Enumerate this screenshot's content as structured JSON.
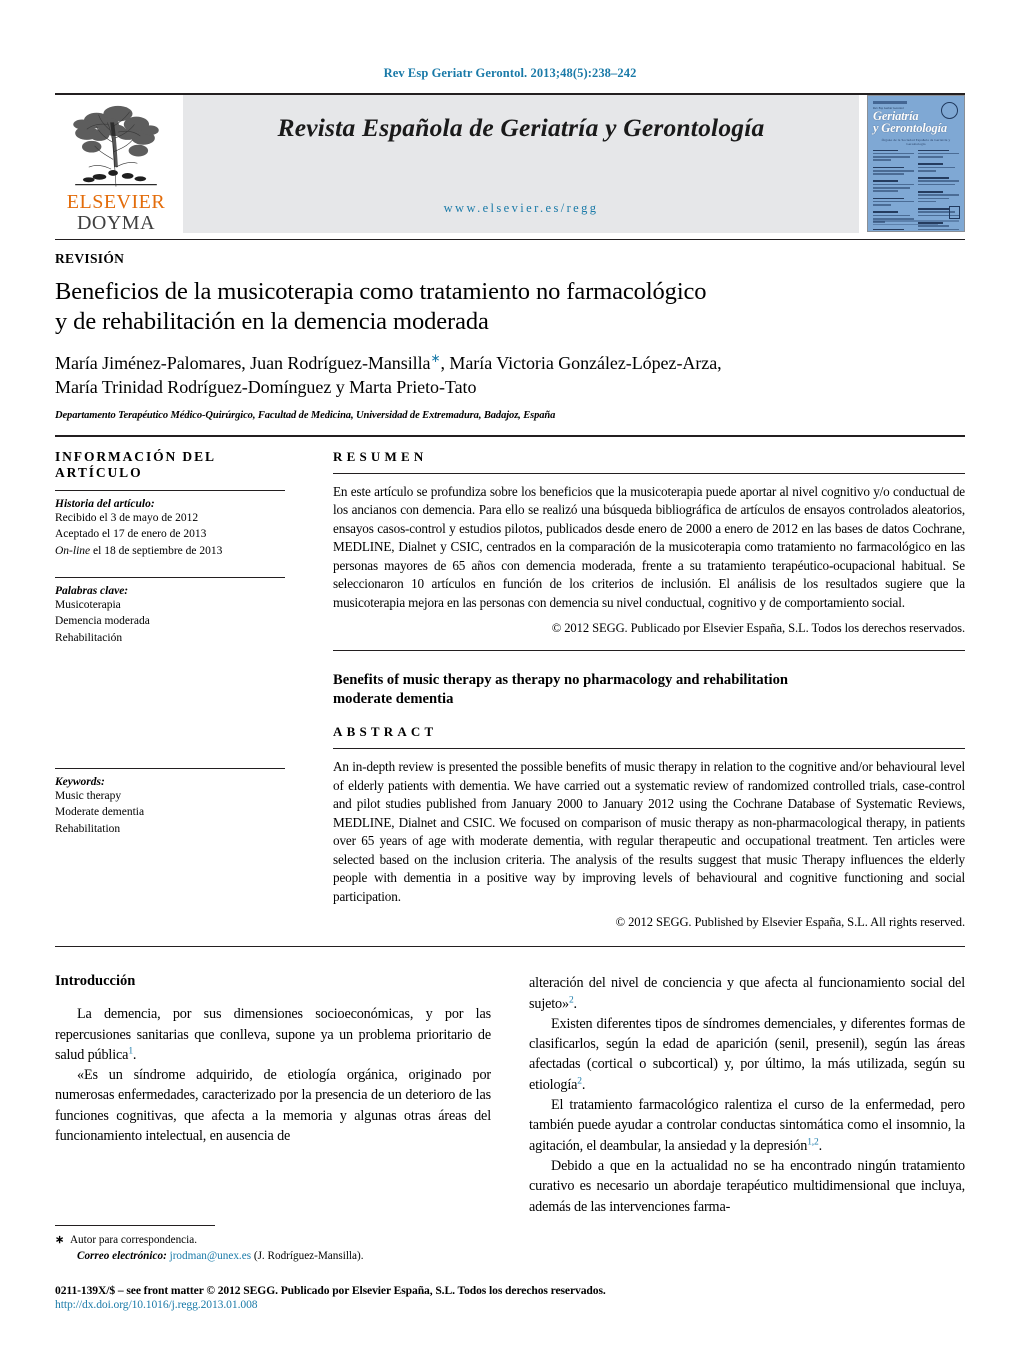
{
  "running_head": "Rev Esp Geriatr Gerontol. 2013;48(5):238–242",
  "masthead": {
    "publisher_top": "ELSEVIER",
    "publisher_bottom": "DOYMA",
    "journal_title": "Revista Española de Geriatría y Gerontología",
    "journal_url": "www.elsevier.es/regg",
    "cover": {
      "line1": "Geriatría",
      "line2": "y Gerontología",
      "kicker": "Rev Esp Geriatr Gerontol",
      "subtitle": "Órgano de la Sociedad Española de Geriatría y Gerontología"
    }
  },
  "article": {
    "type": "REVISIÓN",
    "title_line1": "Beneficios de la musicoterapia como tratamiento no farmacológico",
    "title_line2": "y de rehabilitación en la demencia moderada",
    "authors_line1": "María Jiménez-Palomares,  Juan Rodríguez-Mansilla",
    "authors_marker": "∗",
    "authors_line1b": ",  María Victoria González-López-Arza,",
    "authors_line2": "María Trinidad Rodríguez-Domínguez y Marta Prieto-Tato",
    "affiliation": "Departamento Terapéutico Médico-Quirúrgico, Facultad de Medicina, Universidad de Extremadura, Badajoz, España"
  },
  "info_panel": {
    "heading": "INFORMACIÓN DEL ARTÍCULO",
    "history_label": "Historia del artículo:",
    "history": [
      "Recibido el 3 de mayo de 2012",
      "Aceptado el 17 de enero de 2013"
    ],
    "online_italic": "On-line",
    "online_rest": " el 18 de septiembre de 2013",
    "keywords_label": "Palabras clave:",
    "keywords": [
      "Musicoterapia",
      "Demencia moderada",
      "Rehabilitación"
    ]
  },
  "keywords_panel": {
    "label": "Keywords:",
    "items": [
      "Music therapy",
      "Moderate dementia",
      "Rehabilitation"
    ]
  },
  "resumen": {
    "heading": "RESUMEN",
    "text": "En este artículo se profundiza sobre los beneficios que la musicoterapia puede aportar al nivel cognitivo y/o conductual de los ancianos con demencia. Para ello se realizó una búsqueda bibliográfica de artículos de ensayos controlados aleatorios, ensayos casos-control y estudios pilotos, publicados desde enero de 2000 a enero de 2012 en las bases de datos Cochrane, MEDLINE, Dialnet y CSIC, centrados en la comparación de la musicoterapia como tratamiento no farmacológico en las personas mayores de 65 años con demencia moderada, frente a su tratamiento terapéutico-ocupacional habitual. Se seleccionaron 10 artículos en función de los criterios de inclusión. El análisis de los resultados sugiere que la musicoterapia mejora en las personas con demencia su nivel conductual, cognitivo y de comportamiento social.",
    "copyright": "© 2012 SEGG. Publicado por Elsevier España, S.L. Todos los derechos reservados."
  },
  "abstract": {
    "en_title_line1": "Benefits of music therapy as therapy no pharmacology and rehabilitation",
    "en_title_line2": "moderate dementia",
    "heading": "ABSTRACT",
    "text": "An in-depth review is presented the possible benefits of music therapy in relation to the cognitive and/or behavioural level of elderly patients with dementia. We have carried out a systematic review of randomized controlled trials, case-control and pilot studies published from January 2000 to January 2012 using the Cochrane Database of Systematic Reviews, MEDLINE, Dialnet and CSIC. We focused on comparison of music therapy as non-pharmacological therapy, in patients over 65 years of age with moderate dementia, with regular therapeutic and occupational treatment. Ten articles were selected based on the inclusion criteria. The analysis of the results suggest that music Therapy influences the elderly people with dementia in a positive way by improving levels of behavioural and cognitive functioning and social participation.",
    "copyright": "© 2012 SEGG. Published by Elsevier España, S.L. All rights reserved."
  },
  "intro": {
    "heading": "Introducción",
    "left": {
      "p1_a": "La demencia, por sus dimensiones socioeconómicas, y por las repercusiones sanitarias que conlleva, supone ya un problema prioritario de salud pública",
      "p1_ref": "1",
      "p1_b": ".",
      "p2": "«Es un síndrome adquirido, de etiología orgánica, originado por numerosas enfermedades, caracterizado por la presencia de un deterioro de las funciones cognitivas, que afecta a la memoria y algunas otras áreas del funcionamiento intelectual, en ausencia de"
    },
    "right": {
      "p2_cont_a": "alteración del nivel de conciencia y que afecta al funcionamiento social del sujeto»",
      "p2_cont_ref": "2",
      "p2_cont_b": ".",
      "p3_a": "Existen diferentes tipos de síndromes demenciales, y diferentes formas de clasificarlos, según la edad de aparición (senil, presenil), según las áreas afectadas (cortical o subcortical) y, por último, la más utilizada, según su etiología",
      "p3_ref": "2",
      "p3_b": ".",
      "p4_a": "El tratamiento farmacológico ralentiza el curso de la enfermedad, pero también puede ayudar a controlar conductas sintomática como el insomnio, la agitación, el deambular, la ansiedad y la depresión",
      "p4_ref": "1,2",
      "p4_b": ".",
      "p5": "Debido a que en la actualidad no se ha encontrado ningún tratamiento curativo es necesario un abordaje terapéutico multidimensional que incluya, además de las intervenciones farma-"
    }
  },
  "footnotes": {
    "star": "∗",
    "corresponding": "Autor para correspondencia.",
    "email_label": "Correo electrónico:",
    "email": "jrodman@unex.es",
    "email_author": "(J. Rodríguez-Mansilla)."
  },
  "footer": {
    "issn": "0211-139X/$ – see front matter © 2012 SEGG. Publicado por Elsevier España, S.L. Todos los derechos reservados.",
    "doi": "http://dx.doi.org/10.1016/j.regg.2013.01.008"
  },
  "colors": {
    "link": "#1a7aa8",
    "elsevier_orange": "#e36c0a",
    "band_gray": "#e6e7e9",
    "cover_blue": "#7fa8d4"
  }
}
